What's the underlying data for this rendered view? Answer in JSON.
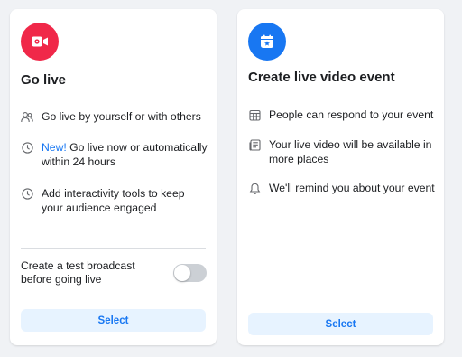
{
  "colors": {
    "go_live_accent": "#f02849",
    "event_accent": "#1877f2",
    "link_blue": "#1877f2",
    "button_bg": "#e7f3ff"
  },
  "go_live": {
    "icon": "video-camera-icon",
    "title": "Go live",
    "features": [
      {
        "icon": "people-icon",
        "text": "Go live by yourself or with others"
      },
      {
        "icon": "clock-icon",
        "tag": "New!",
        "text": " Go live now or automatically within 24 hours"
      },
      {
        "icon": "clock-icon",
        "text": "Add interactivity tools to keep your audience engaged"
      }
    ],
    "test_broadcast_label": "Create a test broadcast before going live",
    "test_broadcast_enabled": false,
    "select_label": "Select"
  },
  "live_event": {
    "icon": "calendar-star-icon",
    "title": "Create live video event",
    "features": [
      {
        "icon": "calendar-grid-icon",
        "text": "People can respond to your event"
      },
      {
        "icon": "news-feed-icon",
        "text": "Your live video will be available in more places"
      },
      {
        "icon": "bell-icon",
        "text": "We'll remind you about your event"
      }
    ],
    "select_label": "Select"
  }
}
